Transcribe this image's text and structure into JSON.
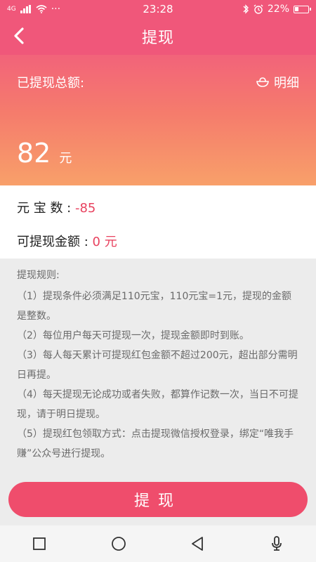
{
  "status_bar": {
    "network": "4G",
    "dots": "···",
    "time": "23:28",
    "battery_percent": "22%"
  },
  "header": {
    "title": "提现",
    "back_icon": "chevron-left-icon"
  },
  "hero": {
    "label": "已提现总额:",
    "detail_label": "明细",
    "detail_icon": "bowl-icon",
    "amount_value": "82",
    "amount_unit": "元"
  },
  "info": {
    "ingots_label": "元 宝 数 :",
    "ingots_value": "-85",
    "withdrawable_label": "可提现金额 :",
    "withdrawable_value": "0 元"
  },
  "rules": {
    "title": "提现规则:",
    "items": [
      "（1）提现条件必须满足110元宝，110元宝=1元，提现的金额是整数。",
      "（2）每位用户每天可提现一次，提现金额即时到账。",
      "（3）每人每天累计可提现红包金额不超过200元，超出部分需明日再提。",
      "（4）每天提现无论成功或者失败，都算作记数一次，当日不可提现，请于明日提现。",
      "（5）提现红包领取方式：点击提现微信授权登录，绑定“唯我手赚”公众号进行提现。"
    ]
  },
  "submit_button": {
    "label": "提现"
  },
  "navbar": {
    "icons": [
      "square-icon",
      "circle-icon",
      "triangle-back-icon",
      "microphone-icon"
    ]
  },
  "colors": {
    "accent": "#ef4d6c",
    "negative_value": "#e8425f"
  }
}
